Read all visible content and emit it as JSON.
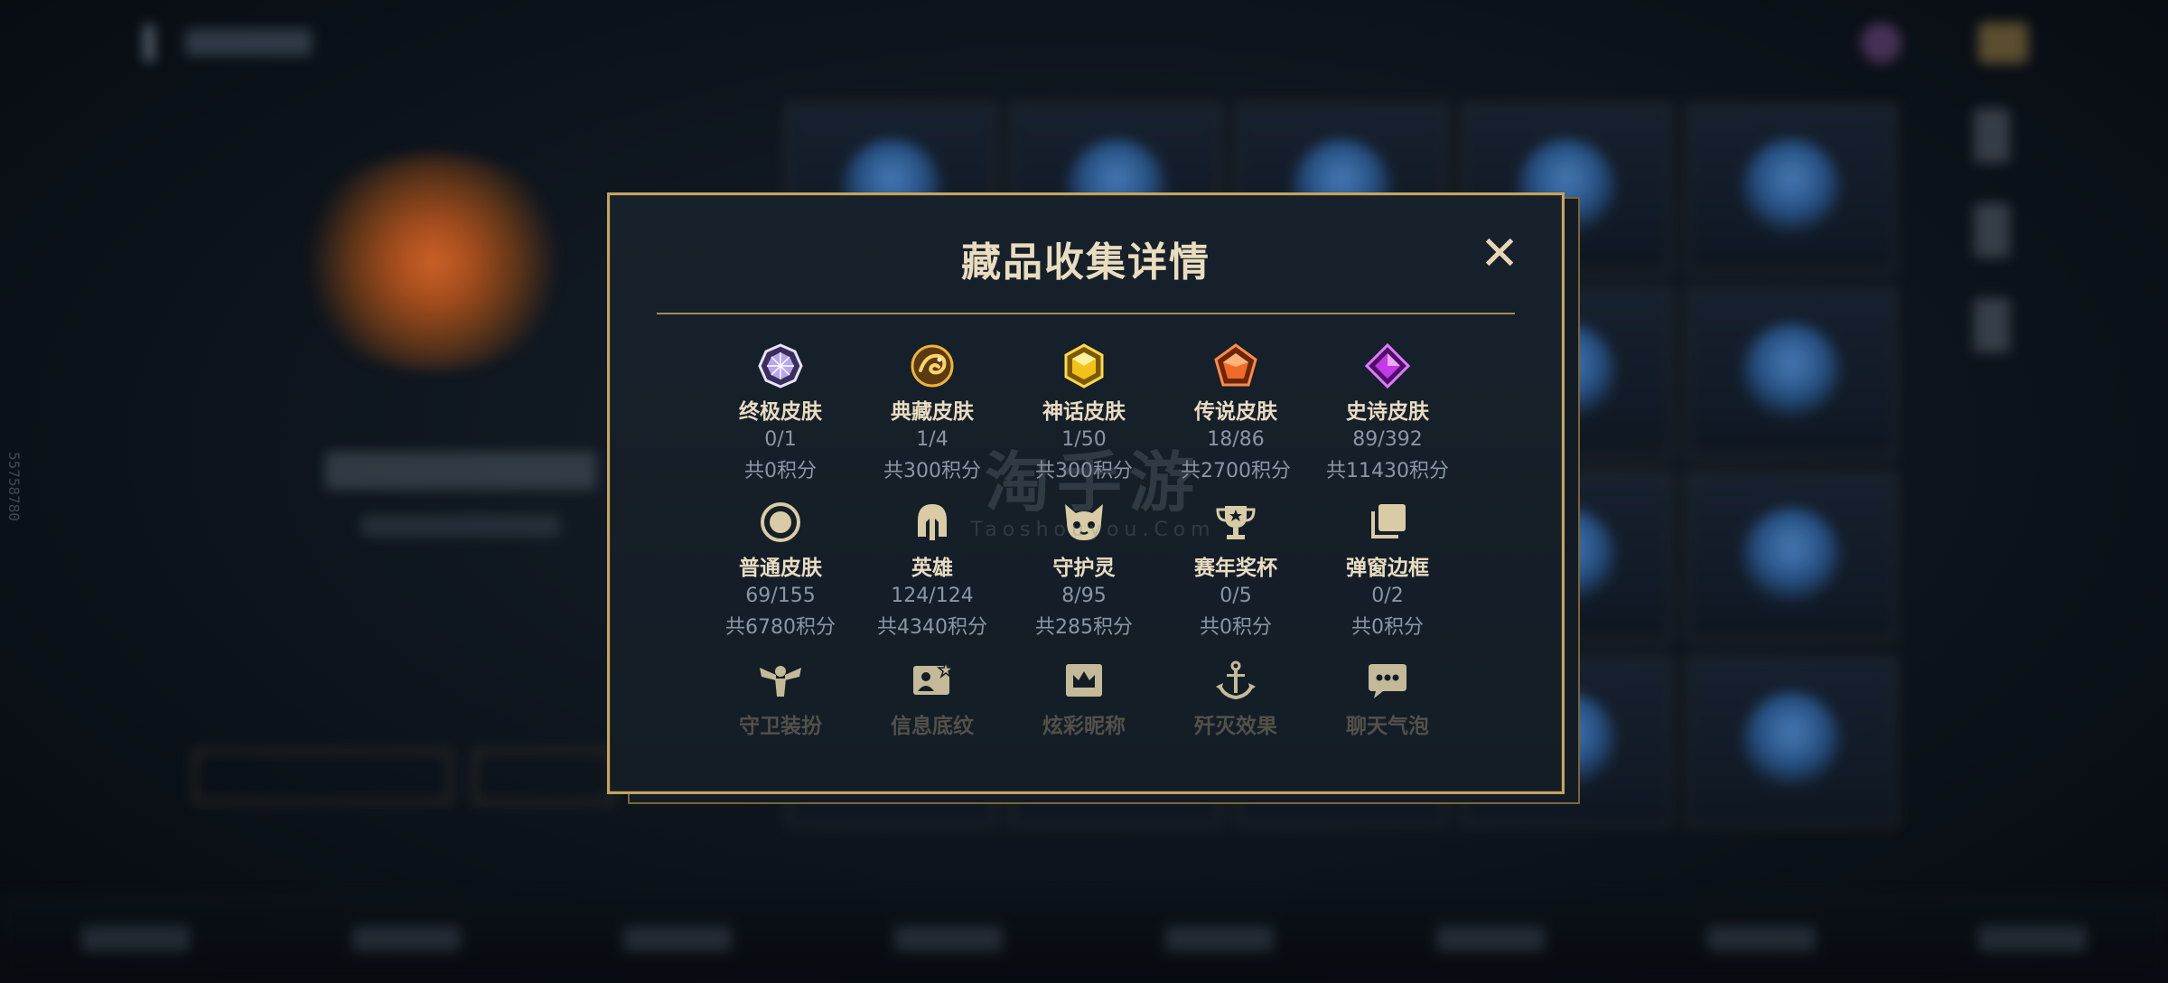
{
  "modal": {
    "title": "藏品收集详情",
    "close_glyph": "✕"
  },
  "rows": [
    [
      {
        "label": "终极皮肤",
        "count": "0/1",
        "points": "共0积分",
        "icon": "ultimate-skin-gem-icon",
        "color": "#b8a6f0"
      },
      {
        "label": "典藏皮肤",
        "count": "1/4",
        "points": "共300积分",
        "icon": "classic-dragon-icon",
        "color": "#e0a53a"
      },
      {
        "label": "神话皮肤",
        "count": "1/50",
        "points": "共300积分",
        "icon": "myth-gem-icon",
        "color": "#f2c21a"
      },
      {
        "label": "传说皮肤",
        "count": "18/86",
        "points": "共2700积分",
        "icon": "legend-gem-icon",
        "color": "#f06a2a"
      },
      {
        "label": "史诗皮肤",
        "count": "89/392",
        "points": "共11430积分",
        "icon": "epic-gem-icon",
        "color": "#c43ae8"
      }
    ],
    [
      {
        "label": "普通皮肤",
        "count": "69/155",
        "points": "共6780积分",
        "icon": "normal-skin-ring-icon",
        "color": "#d8cba6"
      },
      {
        "label": "英雄",
        "count": "124/124",
        "points": "共4340积分",
        "icon": "helmet-icon",
        "color": "#d8cba6"
      },
      {
        "label": "守护灵",
        "count": "8/95",
        "points": "共285积分",
        "icon": "guardian-spirit-icon",
        "color": "#d8cba6"
      },
      {
        "label": "赛年奖杯",
        "count": "0/5",
        "points": "共0积分",
        "icon": "trophy-icon",
        "color": "#d8cba6"
      },
      {
        "label": "弹窗边框",
        "count": "0/2",
        "points": "共0积分",
        "icon": "popup-frame-icon",
        "color": "#d8cba6"
      }
    ],
    [
      {
        "label": "守卫装扮",
        "icon": "guard-outfit-icon",
        "color": "#d8cba6"
      },
      {
        "label": "信息底纹",
        "icon": "info-background-icon",
        "color": "#d8cba6"
      },
      {
        "label": "炫彩昵称",
        "icon": "colorful-nickname-icon",
        "color": "#d8cba6"
      },
      {
        "label": "歼灭效果",
        "icon": "annihilation-effect-icon",
        "color": "#d8cba6"
      },
      {
        "label": "聊天气泡",
        "icon": "chat-bubble-icon",
        "color": "#d8cba6"
      }
    ]
  ],
  "watermark": {
    "cn": "淘手游",
    "en": "Taoshouyou.Com"
  },
  "side_code": "55758780"
}
